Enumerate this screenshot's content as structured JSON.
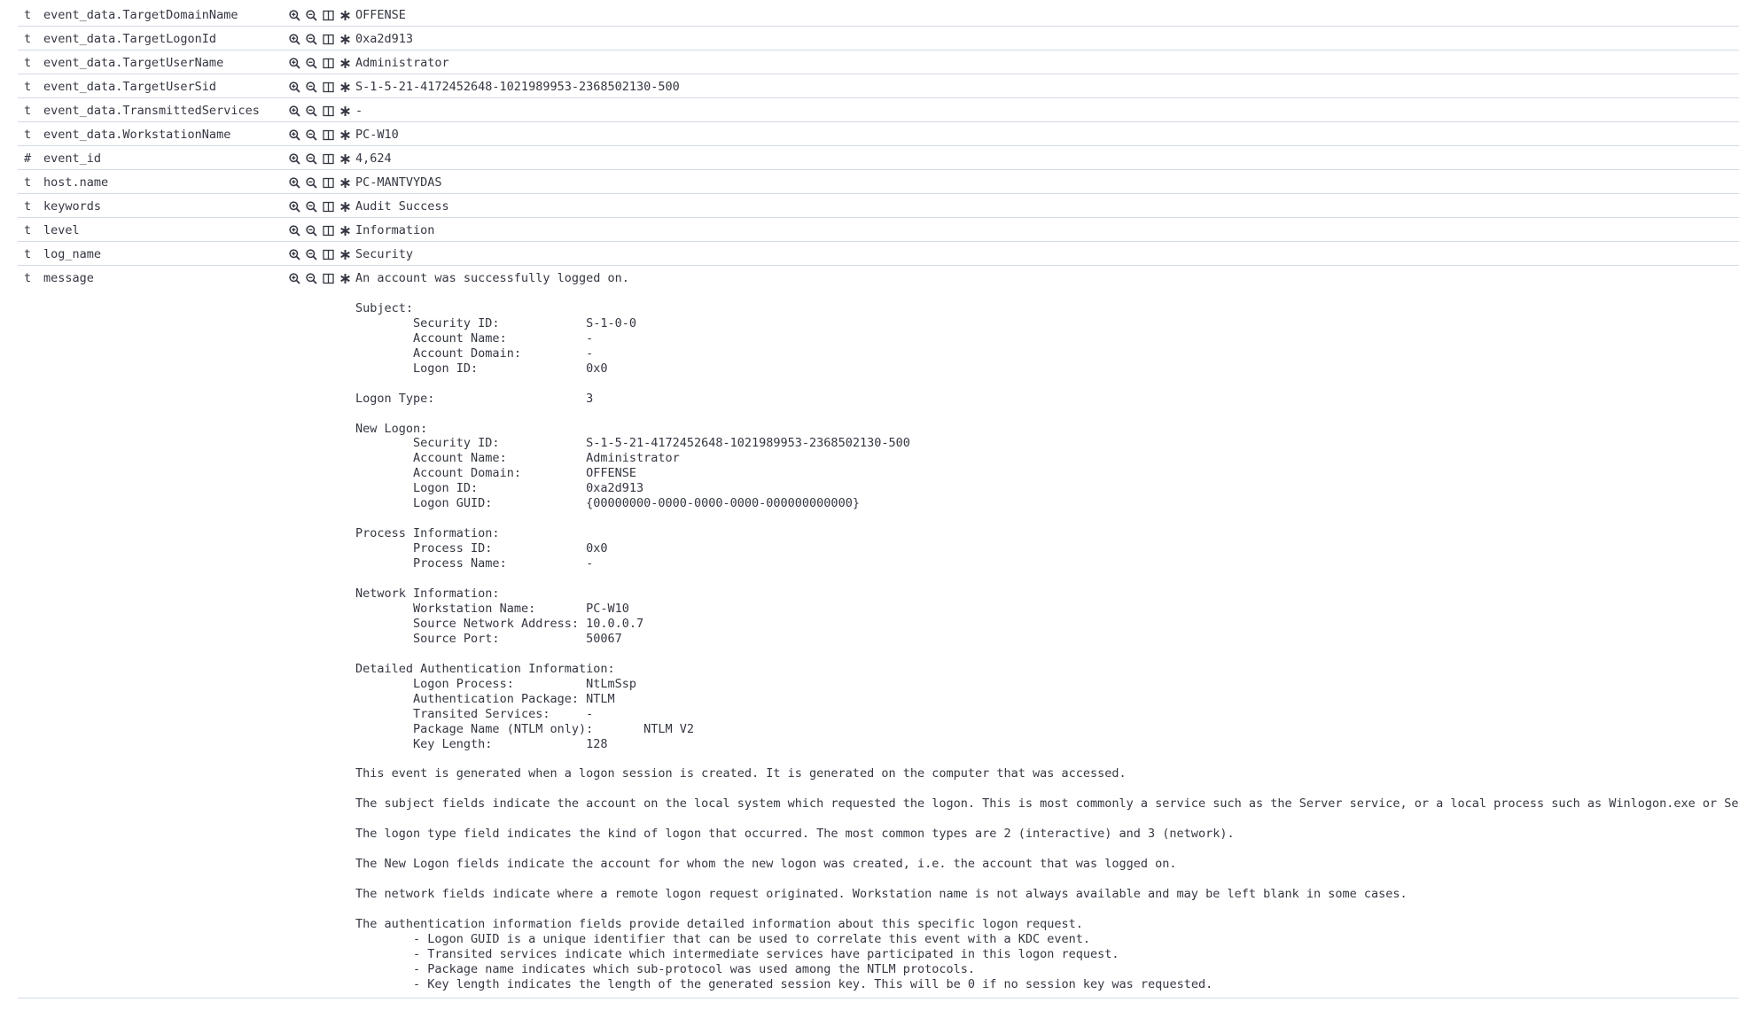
{
  "fields": [
    {
      "type": "t",
      "name": "event_data.TargetDomainName",
      "value": "OFFENSE"
    },
    {
      "type": "t",
      "name": "event_data.TargetLogonId",
      "value": "0xa2d913"
    },
    {
      "type": "t",
      "name": "event_data.TargetUserName",
      "value": "Administrator"
    },
    {
      "type": "t",
      "name": "event_data.TargetUserSid",
      "value": "S-1-5-21-4172452648-1021989953-2368502130-500"
    },
    {
      "type": "t",
      "name": "event_data.TransmittedServices",
      "value": "-"
    },
    {
      "type": "t",
      "name": "event_data.WorkstationName",
      "value": "PC-W10"
    },
    {
      "type": "#",
      "name": "event_id",
      "value": "4,624"
    },
    {
      "type": "t",
      "name": "host.name",
      "value": "PC-MANTVYDAS"
    },
    {
      "type": "t",
      "name": "keywords",
      "value": "Audit Success"
    },
    {
      "type": "t",
      "name": "level",
      "value": "Information"
    },
    {
      "type": "t",
      "name": "log_name",
      "value": "Security"
    }
  ],
  "message": {
    "type": "t",
    "name": "message",
    "value": "An account was successfully logged on.\n\nSubject:\n\tSecurity ID:\t\tS-1-0-0\n\tAccount Name:\t\t-\n\tAccount Domain:\t\t-\n\tLogon ID:\t\t0x0\n\nLogon Type:\t\t\t3\n\nNew Logon:\n\tSecurity ID:\t\tS-1-5-21-4172452648-1021989953-2368502130-500\n\tAccount Name:\t\tAdministrator\n\tAccount Domain:\t\tOFFENSE\n\tLogon ID:\t\t0xa2d913\n\tLogon GUID:\t\t{00000000-0000-0000-0000-000000000000}\n\nProcess Information:\n\tProcess ID:\t\t0x0\n\tProcess Name:\t\t-\n\nNetwork Information:\n\tWorkstation Name:\tPC-W10\n\tSource Network Address:\t10.0.0.7\n\tSource Port:\t\t50067\n\nDetailed Authentication Information:\n\tLogon Process:\t\tNtLmSsp \n\tAuthentication Package:\tNTLM\n\tTransited Services:\t-\n\tPackage Name (NTLM only):\tNTLM V2\n\tKey Length:\t\t128\n\nThis event is generated when a logon session is created. It is generated on the computer that was accessed.\n\nThe subject fields indicate the account on the local system which requested the logon. This is most commonly a service such as the Server service, or a local process such as Winlogon.exe or Services.exe.\n\nThe logon type field indicates the kind of logon that occurred. The most common types are 2 (interactive) and 3 (network).\n\nThe New Logon fields indicate the account for whom the new logon was created, i.e. the account that was logged on.\n\nThe network fields indicate where a remote logon request originated. Workstation name is not always available and may be left blank in some cases.\n\nThe authentication information fields provide detailed information about this specific logon request.\n\t- Logon GUID is a unique identifier that can be used to correlate this event with a KDC event.\n\t- Transited services indicate which intermediate services have participated in this logon request.\n\t- Package name indicates which sub-protocol was used among the NTLM protocols.\n\t- Key length indicates the length of the generated session key. This will be 0 if no session key was requested."
  },
  "action_icons": [
    "zoom-in-icon",
    "zoom-out-icon",
    "toggle-column-icon",
    "filter-exists-icon"
  ]
}
